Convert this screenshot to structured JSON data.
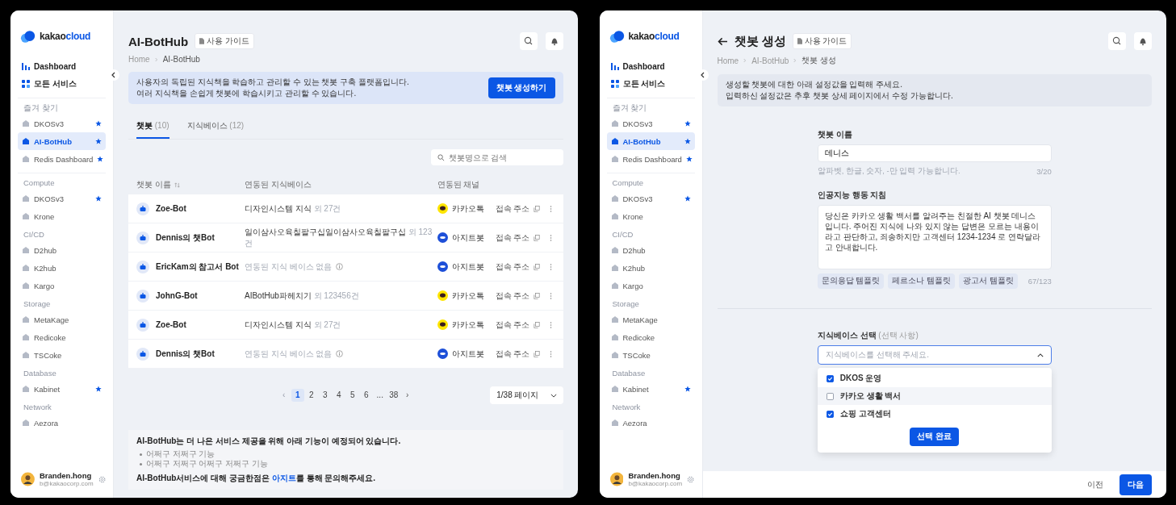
{
  "screens": [
    {
      "kind": "list",
      "sidebar": {
        "logo": [
          "kakao",
          "cloud"
        ],
        "nav": [
          {
            "kind": "dashboard",
            "label": "Dashboard",
            "selected": false
          },
          {
            "kind": "services",
            "label": "모든 서비스",
            "selected": false
          }
        ],
        "sections": [
          {
            "title": "즐겨 찾기",
            "items": [
              {
                "label": "DKOSv3",
                "starred": true,
                "selected": false
              },
              {
                "label": "AI-BotHub",
                "starred": true,
                "selected": true
              },
              {
                "label": "Redis Dashboard",
                "starred": true,
                "selected": false
              }
            ]
          },
          {
            "title": "Compute",
            "items": [
              {
                "label": "DKOSv3",
                "starred": true,
                "selected": false
              },
              {
                "label": "Krone",
                "starred": false,
                "selected": false
              }
            ]
          },
          {
            "title": "CI/CD",
            "items": [
              {
                "label": "D2hub",
                "starred": false,
                "selected": false
              },
              {
                "label": "K2hub",
                "starred": false,
                "selected": false
              },
              {
                "label": "Kargo",
                "starred": false,
                "selected": false
              }
            ]
          },
          {
            "title": "Storage",
            "items": [
              {
                "label": "MetaKage",
                "starred": false,
                "selected": false
              },
              {
                "label": "Redicoke",
                "starred": false,
                "selected": false
              },
              {
                "label": "TSCoke",
                "starred": false,
                "selected": false
              }
            ]
          },
          {
            "title": "Database",
            "items": [
              {
                "label": "Kabinet",
                "starred": true,
                "selected": false
              }
            ]
          },
          {
            "title": "Network",
            "items": [
              {
                "label": "Aezora",
                "starred": false,
                "selected": false
              }
            ]
          }
        ],
        "user": {
          "name": "Branden.hong",
          "email": "b@kakaocorp.com"
        }
      },
      "header": {
        "title": "AI-BotHub",
        "guide_button": "사용 가이드",
        "breadcrumb": [
          "Home",
          "AI-BotHub"
        ]
      },
      "banner": {
        "lines": [
          "사용자의 독립된 지식책을 학습하고 관리할 수 있는 챗봇 구축 플랫폼입니다.",
          "여러 지식책을 손쉽게 챗봇에 학습시키고 관리할 수 있습니다."
        ],
        "button": "챗봇 생성하기"
      },
      "tabs": [
        {
          "label": "챗봇",
          "count": "(10)",
          "selected": true
        },
        {
          "label": "지식베이스",
          "count": "(12)",
          "selected": false
        }
      ],
      "search": {
        "placeholder": "챗봇명으로 검색"
      },
      "table": {
        "columns": [
          "챗봇 이름",
          "연동된 지식베이스",
          "연동된 채널"
        ],
        "rows": [
          {
            "name": "Zoe-Bot",
            "knowledge": {
              "kind": "linked",
              "text": "디자인시스템 지식",
              "extra": "외 27건"
            },
            "channel": {
              "kind": "kakaotalk",
              "label": "카카오톡"
            },
            "address": "접속 주소"
          },
          {
            "name": "Dennis의 챗Bot",
            "knowledge": {
              "kind": "linked",
              "text": "일이삼사오육칠팔구십일이삼사오육칠팔구십",
              "extra": "외 123건"
            },
            "channel": {
              "kind": "agit",
              "label": "아지트봇"
            },
            "address": "접속 주소"
          },
          {
            "name": "EricKam의 참고서 Bot",
            "knowledge": {
              "kind": "none",
              "text": "연동된 지식 베이스 없음"
            },
            "channel": {
              "kind": "agit",
              "label": "아지트봇"
            },
            "address": "접속 주소"
          },
          {
            "name": "JohnG-Bot",
            "knowledge": {
              "kind": "linked",
              "text": "AIBotHub파헤치기",
              "extra": "외 123456건"
            },
            "channel": {
              "kind": "kakaotalk",
              "label": "카카오톡"
            },
            "address": "접속 주소"
          },
          {
            "name": "Zoe-Bot",
            "knowledge": {
              "kind": "linked",
              "text": "디자인시스템 지식",
              "extra": "외 27건"
            },
            "channel": {
              "kind": "kakaotalk",
              "label": "카카오톡"
            },
            "address": "접속 주소"
          },
          {
            "name": "Dennis의 챗Bot",
            "knowledge": {
              "kind": "none",
              "text": "연동된 지식 베이스 없음"
            },
            "channel": {
              "kind": "agit",
              "label": "아지트봇"
            },
            "address": "접속 주소"
          }
        ]
      },
      "pagination": {
        "prev": {
          "label": "‹",
          "disabled": true
        },
        "next": {
          "label": "›",
          "disabled": false
        },
        "pages": [
          {
            "label": "1",
            "selected": true
          },
          {
            "label": "2",
            "selected": false
          },
          {
            "label": "3",
            "selected": false
          },
          {
            "label": "4",
            "selected": false
          },
          {
            "label": "5",
            "selected": false
          },
          {
            "label": "6",
            "selected": false
          },
          {
            "label": "...",
            "selected": false
          },
          {
            "label": "38",
            "selected": false
          }
        ],
        "page_select": "1/38 페이지"
      },
      "notice": {
        "title": "AI-BotHub는 더 나은 서비스 제공을 위해 아래 기능이 예정되어 있습니다.",
        "items": [
          "어쩌구 저쩌구 기능",
          "어쩌구 저쩌구 어쩌구 저쩌구 기능"
        ],
        "footer_before": "AI-BotHub서비스에 대해 궁금한점은 ",
        "footer_link": "아지트",
        "footer_after": "를 통해 문의해주세요."
      }
    },
    {
      "kind": "create",
      "sidebar": {
        "logo": [
          "kakao",
          "cloud"
        ],
        "nav": [
          {
            "kind": "dashboard",
            "label": "Dashboard",
            "selected": false
          },
          {
            "kind": "services",
            "label": "모든 서비스",
            "selected": false
          }
        ],
        "sections": [
          {
            "title": "즐겨 찾기",
            "items": [
              {
                "label": "DKOSv3",
                "starred": true,
                "selected": false
              },
              {
                "label": "AI-BotHub",
                "starred": true,
                "selected": true
              },
              {
                "label": "Redis Dashboard",
                "starred": true,
                "selected": false
              }
            ]
          },
          {
            "title": "Compute",
            "items": [
              {
                "label": "DKOSv3",
                "starred": true,
                "selected": false
              },
              {
                "label": "Krone",
                "starred": false,
                "selected": false
              }
            ]
          },
          {
            "title": "CI/CD",
            "items": [
              {
                "label": "D2hub",
                "starred": false,
                "selected": false
              },
              {
                "label": "K2hub",
                "starred": false,
                "selected": false
              },
              {
                "label": "Kargo",
                "starred": false,
                "selected": false
              }
            ]
          },
          {
            "title": "Storage",
            "items": [
              {
                "label": "MetaKage",
                "starred": false,
                "selected": false
              },
              {
                "label": "Redicoke",
                "starred": false,
                "selected": false
              },
              {
                "label": "TSCoke",
                "starred": false,
                "selected": false
              }
            ]
          },
          {
            "title": "Database",
            "items": [
              {
                "label": "Kabinet",
                "starred": true,
                "selected": false
              }
            ]
          },
          {
            "title": "Network",
            "items": [
              {
                "label": "Aezora",
                "starred": false,
                "selected": false
              }
            ]
          }
        ],
        "user": {
          "name": "Branden.hong",
          "email": "b@kakaocorp.com"
        }
      },
      "header": {
        "title": "챗봇 생성",
        "guide_button": "사용 가이드",
        "breadcrumb": [
          "Home",
          "AI-BotHub",
          "챗봇 생성"
        ]
      },
      "banner": {
        "lines": [
          "생성할 챗봇에 대한 아래 설정값을 입력해 주세요.",
          "입력하신 설정값은 추후 챗봇 상세 페이지에서 수정 가능합니다."
        ]
      },
      "form": {
        "name_field": {
          "label": "챗봇 이름",
          "value": "데니스",
          "hint": "알파벳, 한글, 숫자, -만 입력 가능합니다.",
          "count": "3/20"
        },
        "prompt_field": {
          "label": "인공지능 행동 지침",
          "value": "당신은 카카오 생활 백서를 알려주는 친절한 AI 챗봇 데니스 입니다. 주어진 지식에 나와 있지 않는 답변은 모르는 내용이라고 판단하고, 죄송하지만 고객센터 1234-1234 로 연락달라고 안내합니다.",
          "templates": [
            "문의응답 템플릿",
            "페르소나 템플릿",
            "광고서 템플릿"
          ],
          "count": "67/123"
        },
        "knowledge_select": {
          "label": "지식베이스 선택",
          "optional": "(선택 사항)",
          "placeholder": "지식베이스를 선택해 주세요.",
          "expanded": true,
          "options": [
            {
              "label": "DKOS 운영",
              "checked": true,
              "hovered": false
            },
            {
              "label": "카카오 생활 백서",
              "checked": false,
              "hovered": true
            },
            {
              "label": "쇼핑 고객센터",
              "checked": true,
              "hovered": false
            }
          ],
          "confirm": "선택 완료"
        }
      },
      "footer": {
        "prev": "이전",
        "next": "다음"
      }
    }
  ]
}
